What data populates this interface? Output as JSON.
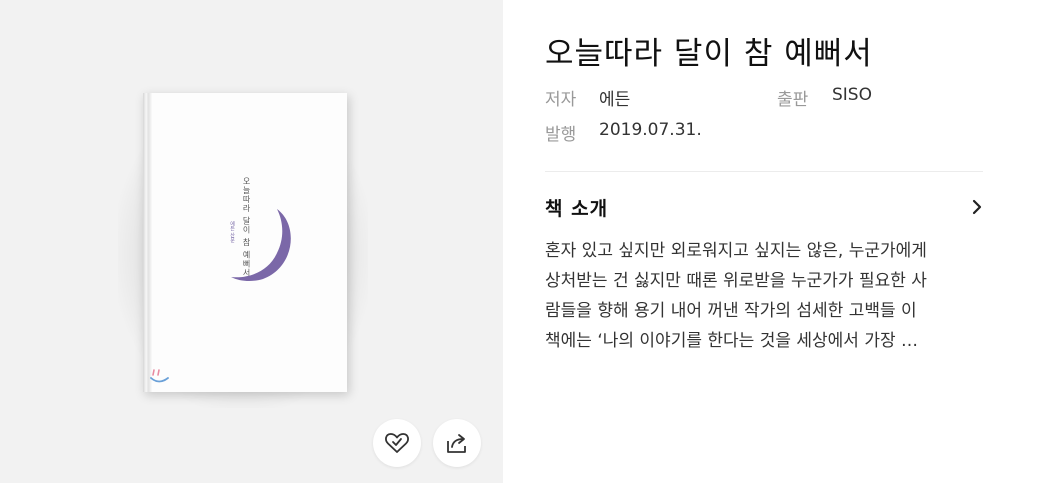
{
  "book": {
    "title": "오늘따라 달이 참 예뻐서",
    "cover_title": "오늘따라 달이 참 예뻐서",
    "cover_author": "에든 산문"
  },
  "meta": {
    "author_label": "저자",
    "author_value": "에든",
    "publisher_label": "출판",
    "publisher_value": "SISO",
    "date_label": "발행",
    "date_value": "2019.07.31."
  },
  "intro": {
    "heading": "책 소개",
    "lines": [
      "혼자 있고 싶지만 외로워지고 싶지는 않은, 누군가에게",
      "상처받는 건 싫지만 때론 위로받을 누군가가 필요한 사",
      "람들을 향해 용기 내어 꺼낸 작가의 섬세한 고백들 이",
      "책에는 ‘나의 이야기를 한다는 것을 세상에서 가장 …"
    ]
  },
  "icons": {
    "like": "heart-icon",
    "share": "share-icon",
    "more": "chevron-right-icon"
  },
  "colors": {
    "moon": "#7b68a8",
    "panel_bg": "#f2f2f2"
  }
}
